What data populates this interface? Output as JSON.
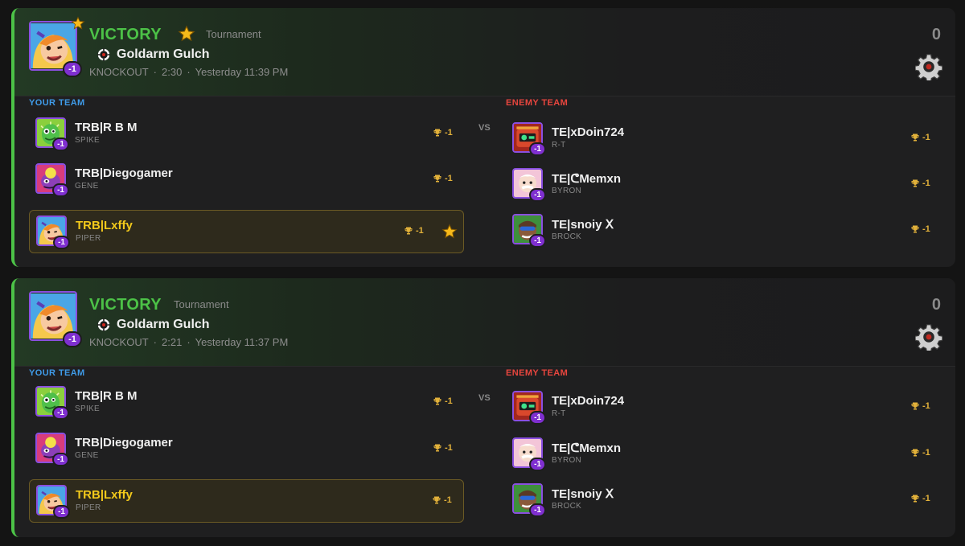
{
  "matches": [
    {
      "result": "VICTORY",
      "event_type": "Tournament",
      "map": "Goldarm Gulch",
      "mode": "KNOCKOUT",
      "duration": "2:30",
      "time": "Yesterday 11:39 PM",
      "score": "0",
      "hero_badge": "-1",
      "your_team_label": "YOUR TEAM",
      "enemy_team_label": "ENEMY TEAM",
      "vs": "VS",
      "your_team": [
        {
          "name": "TRB|R B M",
          "brawler": "SPIKE",
          "trophies": "-1",
          "badge": "-1"
        },
        {
          "name": "TRB|Diegogamer",
          "brawler": "GENE",
          "trophies": "-1",
          "badge": "-1"
        },
        {
          "name": "TRB|Lxffy",
          "brawler": "PIPER",
          "trophies": "-1",
          "badge": "-1"
        }
      ],
      "enemy_team": [
        {
          "name": "TE|xDoin724",
          "brawler": "R-T",
          "trophies": "-1",
          "badge": "-1"
        },
        {
          "name": "TE|ᕦMemxn",
          "brawler": "BYRON",
          "trophies": "-1",
          "badge": "-1"
        },
        {
          "name": "TE|snoiy ꓫ",
          "brawler": "BROCK",
          "trophies": "-1",
          "badge": "-1"
        }
      ]
    },
    {
      "result": "VICTORY",
      "event_type": "Tournament",
      "map": "Goldarm Gulch",
      "mode": "KNOCKOUT",
      "duration": "2:21",
      "time": "Yesterday 11:37 PM",
      "score": "0",
      "hero_badge": "-1",
      "your_team_label": "YOUR TEAM",
      "enemy_team_label": "ENEMY TEAM",
      "vs": "VS",
      "your_team": [
        {
          "name": "TRB|R B M",
          "brawler": "SPIKE",
          "trophies": "-1",
          "badge": "-1"
        },
        {
          "name": "TRB|Diegogamer",
          "brawler": "GENE",
          "trophies": "-1",
          "badge": "-1"
        },
        {
          "name": "TRB|Lxffy",
          "brawler": "PIPER",
          "trophies": "-1",
          "badge": "-1"
        }
      ],
      "enemy_team": [
        {
          "name": "TE|xDoin724",
          "brawler": "R-T",
          "trophies": "-1",
          "badge": "-1"
        },
        {
          "name": "TE|ᕦMemxn",
          "brawler": "BYRON",
          "trophies": "-1",
          "badge": "-1"
        },
        {
          "name": "TE|snoiy ꓫ",
          "brawler": "BROCK",
          "trophies": "-1",
          "badge": "-1"
        }
      ]
    }
  ],
  "colors": {
    "victory": "#4cc247",
    "your_team": "#3f9be8",
    "enemy_team": "#e8463e",
    "trophy": "#e2b13a",
    "highlight_name": "#f2c91b",
    "badge": "#7f2fd0"
  },
  "icons": {
    "star": "star-icon",
    "trophy": "trophy-icon",
    "map": "bounty-target-icon",
    "gear": "gear-icon"
  }
}
